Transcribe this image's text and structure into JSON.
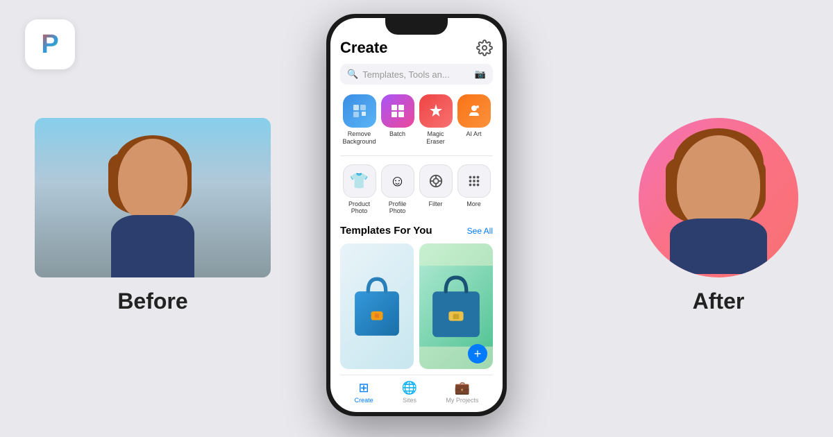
{
  "app": {
    "logo_letter": "P"
  },
  "before": {
    "label": "Before"
  },
  "after": {
    "label": "After"
  },
  "phone": {
    "title": "Create",
    "search_placeholder": "Templates, Tools an...",
    "tools_row1": [
      {
        "id": "remove-bg",
        "label": "Remove\nBackground",
        "icon": "🖼",
        "color_class": "icon-blue"
      },
      {
        "id": "batch",
        "label": "Batch",
        "icon": "⊞",
        "color_class": "icon-purple"
      },
      {
        "id": "magic-eraser",
        "label": "Magic\nEraser",
        "icon": "✦",
        "color_class": "icon-red"
      },
      {
        "id": "ai-art",
        "label": "AI Art",
        "icon": "🎨",
        "color_class": "icon-orange"
      }
    ],
    "tools_row2": [
      {
        "id": "product-photo",
        "label": "Product\nPhoto",
        "icon": "👕",
        "color_class": "icon-gray"
      },
      {
        "id": "profile-photo",
        "label": "Profile\nPhoto",
        "icon": "☺",
        "color_class": "icon-gray"
      },
      {
        "id": "filter",
        "label": "Filter",
        "icon": "⊕",
        "color_class": "icon-gray"
      },
      {
        "id": "more",
        "label": "More",
        "icon": "⠿",
        "color_class": "icon-gray"
      }
    ],
    "templates_section": {
      "title": "Templates For You",
      "see_all": "See All"
    },
    "nav": [
      {
        "id": "create",
        "label": "Create",
        "active": true
      },
      {
        "id": "sites",
        "label": "Sites",
        "active": false
      },
      {
        "id": "my-projects",
        "label": "My Projects",
        "active": false
      }
    ]
  }
}
